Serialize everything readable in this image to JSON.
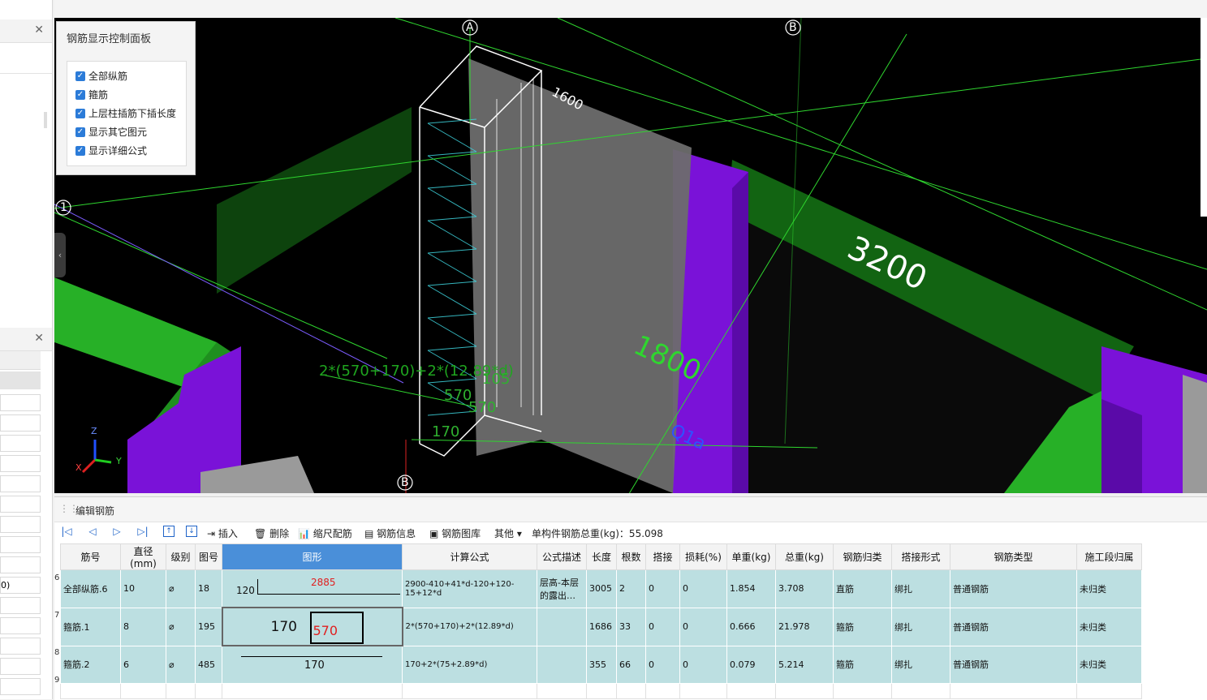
{
  "panel": {
    "title": "钢筋显示控制面板",
    "options": [
      {
        "label": "全部纵筋",
        "checked": true
      },
      {
        "label": "箍筋",
        "checked": true
      },
      {
        "label": "上层柱插筋下插长度",
        "checked": true
      },
      {
        "label": "显示其它图元",
        "checked": true
      },
      {
        "label": "显示详细公式",
        "checked": true
      }
    ]
  },
  "viewport": {
    "axis_labels": [
      "A",
      "B",
      "1",
      "B"
    ],
    "dims": [
      "1600",
      "3200",
      "1800"
    ],
    "formula_overlay": "2*(570+170)+2*(12.89*d)",
    "small_labels": [
      "570",
      "570",
      "170",
      "105"
    ],
    "beam_tag": "Q1a",
    "triad": [
      "Z",
      "X",
      "Y"
    ]
  },
  "left": {
    "cut_value": "0)"
  },
  "editor": {
    "title": "编辑钢筋",
    "toolbar": {
      "insert": "插入",
      "delete": "删除",
      "scale": "缩尺配筋",
      "info": "钢筋信息",
      "library": "钢筋图库",
      "other": "其他",
      "total": "单构件钢筋总重(kg)：55.098"
    },
    "columns": [
      "筋号",
      "直径(mm)",
      "级别",
      "图号",
      "图形",
      "计算公式",
      "公式描述",
      "长度",
      "根数",
      "搭接",
      "损耗(%)",
      "单重(kg)",
      "总重(kg)",
      "钢筋归类",
      "搭接形式",
      "钢筋类型",
      "施工段归属"
    ],
    "rows": [
      {
        "num": "6",
        "name": "全部纵筋.6",
        "dia": "10",
        "grade": "⌀",
        "fig": "18",
        "shape_a": "120",
        "shape_b": "2885",
        "formula": "2900-410+41*d-120+120-15+12*d",
        "desc": "层高-本层的露出…",
        "len": "3005",
        "count": "2",
        "lap": "0",
        "loss": "0",
        "unit": "1.854",
        "total": "3.708",
        "cat": "直筋",
        "lapform": "绑扎",
        "type": "普通钢筋",
        "stage": "未归类"
      },
      {
        "num": "7",
        "name": "箍筋.1",
        "dia": "8",
        "grade": "⌀",
        "fig": "195",
        "shape_a": "170",
        "shape_b": "570",
        "formula": "2*(570+170)+2*(12.89*d)",
        "desc": "",
        "len": "1686",
        "count": "33",
        "lap": "0",
        "loss": "0",
        "unit": "0.666",
        "total": "21.978",
        "cat": "箍筋",
        "lapform": "绑扎",
        "type": "普通钢筋",
        "stage": "未归类"
      },
      {
        "num": "8",
        "name": "箍筋.2",
        "dia": "6",
        "grade": "⌀",
        "fig": "485",
        "shape_a": "170",
        "shape_b": "",
        "formula": "170+2*(75+2.89*d)",
        "desc": "",
        "len": "355",
        "count": "66",
        "lap": "0",
        "loss": "0",
        "unit": "0.079",
        "total": "5.214",
        "cat": "箍筋",
        "lapform": "绑扎",
        "type": "普通钢筋",
        "stage": "未归类"
      }
    ],
    "empty_row_num": "9"
  }
}
